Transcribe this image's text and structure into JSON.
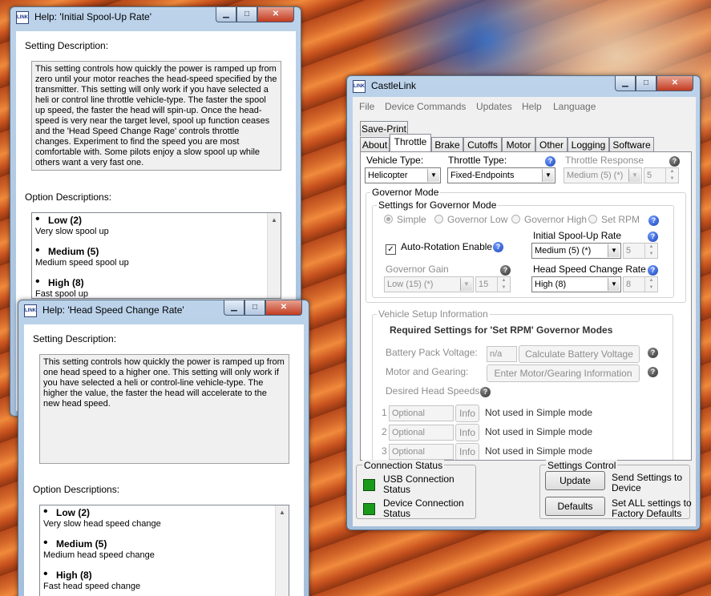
{
  "help1": {
    "title": "Help: 'Initial Spool-Up Rate'",
    "setting_description_label": "Setting Description:",
    "description": "This setting controls how quickly the power is ramped up from zero until your motor reaches the head-speed specified by the transmitter. This setting will only work if you have selected a heli or control line throttle vehicle-type. The faster the spool up speed, the faster the head will spin-up. Once the head-speed is very near the target level, spool up function ceases and the 'Head Speed Change Rage' controls throttle changes. Experiment to find the speed you are most comfortable with. Some pilots enjoy a slow spool up while others want a very fast one.",
    "option_descriptions_label": "Option Descriptions:",
    "options": [
      {
        "name": "Low (2)",
        "desc": "Very slow spool up"
      },
      {
        "name": "Medium (5)",
        "desc": "Medium speed spool up"
      },
      {
        "name": "High (8)",
        "desc": "Fast spool up"
      }
    ]
  },
  "help2": {
    "title": "Help: 'Head Speed Change Rate'",
    "setting_description_label": "Setting Description:",
    "description": "This setting controls how quickly the power is ramped up from one head speed to a higher one. This setting will only work if you have selected a heli or control-line vehicle-type. The higher the value, the faster the head will accelerate to the new head speed.",
    "option_descriptions_label": "Option Descriptions:",
    "options": [
      {
        "name": "Low (2)",
        "desc": "Very slow head speed change"
      },
      {
        "name": "Medium (5)",
        "desc": "Medium head speed change"
      },
      {
        "name": "High (8)",
        "desc": "Fast head speed change"
      }
    ]
  },
  "window_controls": {
    "minimize": "▁",
    "maximize": "□",
    "close": "✕"
  },
  "castlelink": {
    "title": "CastleLink",
    "menu": [
      "File",
      "Device Commands",
      "Updates",
      "Help",
      "Language"
    ],
    "tab_top": "Save-Print",
    "tabs": [
      "About",
      "Throttle",
      "Brake",
      "Cutoffs",
      "Motor",
      "Other",
      "Logging",
      "Software"
    ],
    "vehicle_type": {
      "label": "Vehicle Type:",
      "value": "Helicopter"
    },
    "throttle_type": {
      "label": "Throttle Type:",
      "value": "Fixed-Endpoints"
    },
    "throttle_response": {
      "label": "Throttle Response",
      "value": "Medium (5) (*)",
      "spin": "5"
    },
    "governor_mode_label": "Governor Mode",
    "settings_gov_label": "Settings for Governor Mode",
    "radios": [
      "Simple",
      "Governor Low",
      "Governor High",
      "Set RPM"
    ],
    "auto_rotation": {
      "label": "Auto-Rotation Enable",
      "check": "✓"
    },
    "initial_spool": {
      "label": "Initial Spool-Up Rate",
      "value": "Medium (5) (*)",
      "spin": "5"
    },
    "governor_gain": {
      "label": "Governor Gain",
      "value": "Low (15) (*)",
      "spin": "15"
    },
    "head_speed_change": {
      "label": "Head Speed Change Rate",
      "value": "High (8)",
      "spin": "8"
    },
    "vehicle_setup_label": "Vehicle Setup Information",
    "required_settings": "Required Settings for 'Set RPM' Governor Modes",
    "battery_label": "Battery Pack Voltage:",
    "battery_value": "n/a",
    "calc_battery_button": "Calculate Battery Voltage",
    "motor_gearing_label": "Motor and Gearing:",
    "motor_gearing_button": "Enter Motor/Gearing Information",
    "desired_head_label": "Desired Head Speeds:",
    "head_speeds": [
      {
        "num": "1",
        "placeholder": "Optional",
        "info": "Info",
        "note": "Not used in Simple mode"
      },
      {
        "num": "2",
        "placeholder": "Optional",
        "info": "Info",
        "note": "Not used in Simple mode"
      },
      {
        "num": "3",
        "placeholder": "Optional",
        "info": "Info",
        "note": "Not used in Simple mode"
      }
    ],
    "connection_status_label": "Connection Status",
    "usb_status": "USB Connection Status",
    "device_status": "Device Connection Status",
    "settings_control_label": "Settings Control",
    "update_button": "Update",
    "update_desc": "Send Settings to Device",
    "defaults_button": "Defaults",
    "defaults_desc": "Set ALL settings to Factory Defaults"
  },
  "colors": {
    "led_green": "#1a9a1a",
    "help_icon_blue": "#1c44b8"
  }
}
